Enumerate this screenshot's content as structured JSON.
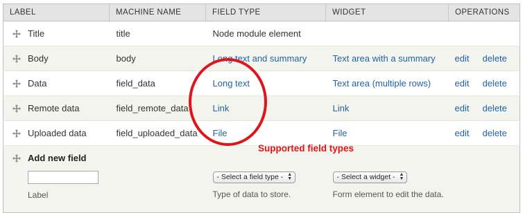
{
  "columns": {
    "label": "LABEL",
    "machine": "MACHINE NAME",
    "type": "FIELD TYPE",
    "widget": "WIDGET",
    "operations": "OPERATIONS"
  },
  "fields": [
    {
      "label": "Title",
      "machine": "title",
      "type": "Node module element",
      "widget": "",
      "edit": "",
      "delete": ""
    },
    {
      "label": "Body",
      "machine": "body",
      "type": "Long text and summary",
      "widget": "Text area with a summary",
      "edit": "edit",
      "delete": "delete"
    },
    {
      "label": "Data",
      "machine": "field_data",
      "type": "Long text",
      "widget": "Text area (multiple rows)",
      "edit": "edit",
      "delete": "delete"
    },
    {
      "label": "Remote data",
      "machine": "field_remote_data",
      "type": "Link",
      "widget": "Link",
      "edit": "edit",
      "delete": "delete"
    },
    {
      "label": "Uploaded data",
      "machine": "field_uploaded_data",
      "type": "File",
      "widget": "File",
      "edit": "edit",
      "delete": "delete"
    }
  ],
  "add_field": {
    "title": "Add new field",
    "label_value": "",
    "label_description": "Label",
    "type_select": "- Select a field type -",
    "type_description": "Type of data to store.",
    "widget_select": "- Select a widget -",
    "widget_description": "Form element to edit the data."
  },
  "annotation": {
    "text": "Supported field types",
    "color": "#e0141b"
  },
  "colors": {
    "link": "#1f62a8",
    "header_bg": "#e4e4e4",
    "even_row_bg": "#f3f4ee"
  },
  "icons": {
    "drag_handle": "move-arrows-icon",
    "select_arrows": "updown-arrows-icon"
  }
}
